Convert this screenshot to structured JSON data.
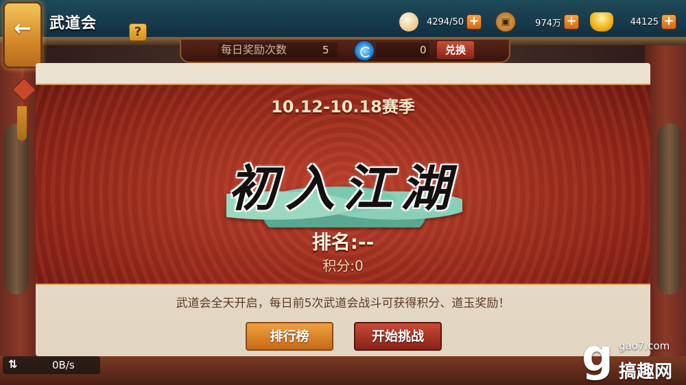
{
  "header": {
    "title": "武道会",
    "help": "?",
    "back": "←"
  },
  "currencies": [
    {
      "name": "stamina",
      "icon": "steamed-bun-icon",
      "value": "4294/50"
    },
    {
      "name": "copper",
      "icon": "copper-coin-icon",
      "value": "974万"
    },
    {
      "name": "gold",
      "icon": "gold-ingot-icon",
      "value": "44125"
    }
  ],
  "plus": "+",
  "reward_bar": {
    "label": "每日奖励次数",
    "count": "5",
    "jade_count": "0",
    "exchange_label": "兑换"
  },
  "season": {
    "title": "10.12-10.18赛季",
    "tier": "初入江湖",
    "rank": "排名:--",
    "score": "积分:0"
  },
  "info_text": "武道会全天开启，每日前5次武道会战斗可获得积分、道玉奖励！",
  "buttons": {
    "leaderboard": "排行榜",
    "start": "开始挑战"
  },
  "netbar": {
    "arrows": "⇅",
    "speed": "0B/s"
  },
  "watermark": {
    "logo": "g",
    "url": "gao7.com",
    "name": "搞趣网"
  },
  "colors": {
    "topbar": "#16384a",
    "banner": "#8a2418",
    "panel": "#e8dccb",
    "accent_orange": "#f0a040",
    "accent_red": "#c84a36"
  }
}
